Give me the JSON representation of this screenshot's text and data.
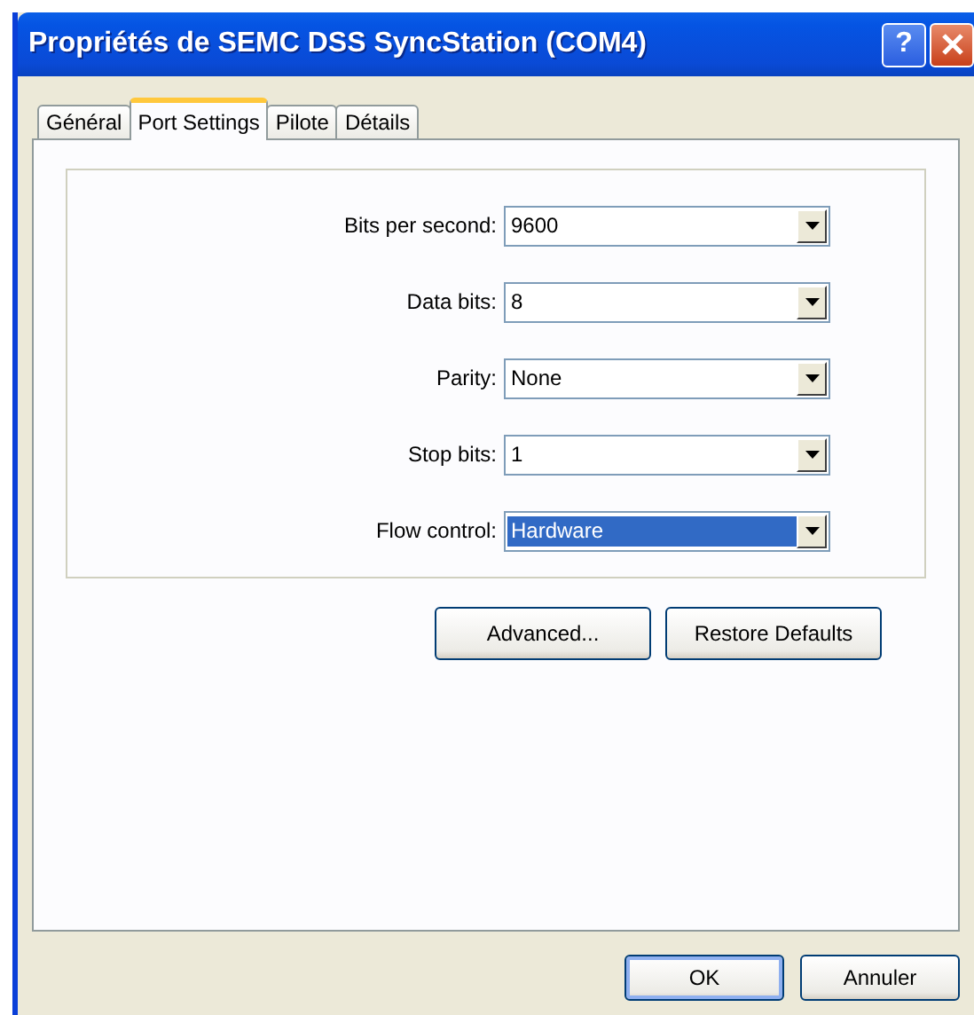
{
  "window": {
    "title": "Propriétés de SEMC DSS SyncStation (COM4)",
    "help_button": "?"
  },
  "tabs": [
    {
      "label": "Général",
      "selected": false
    },
    {
      "label": "Port Settings",
      "selected": true
    },
    {
      "label": "Pilote",
      "selected": false
    },
    {
      "label": "Détails",
      "selected": false
    }
  ],
  "settings": [
    {
      "label": "Bits per second:",
      "value": "9600",
      "focused": false
    },
    {
      "label": "Data bits:",
      "value": "8",
      "focused": false
    },
    {
      "label": "Parity:",
      "value": "None",
      "focused": false
    },
    {
      "label": "Stop bits:",
      "value": "1",
      "focused": false
    },
    {
      "label": "Flow control:",
      "value": "Hardware",
      "focused": true
    }
  ],
  "panel_buttons": [
    "Advanced...",
    "Restore Defaults"
  ],
  "dialog_buttons": [
    {
      "label": "OK",
      "default": true
    },
    {
      "label": "Annuler",
      "default": false
    }
  ]
}
